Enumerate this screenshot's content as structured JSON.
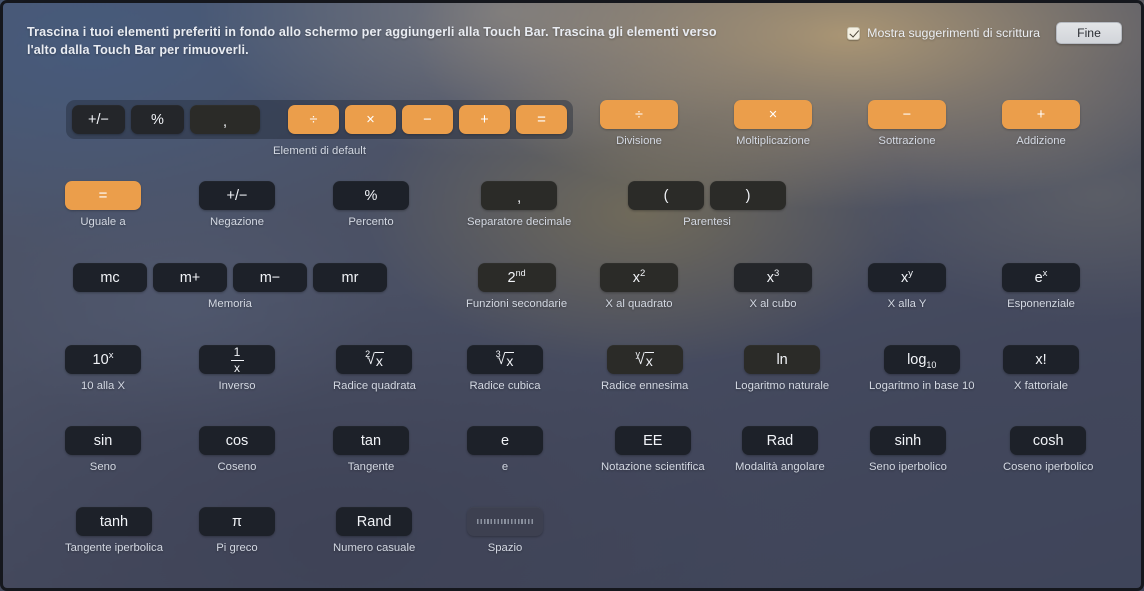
{
  "header": {
    "instructions": "Trascina i tuoi elementi preferiti in fondo allo schermo per aggiungerli alla Touch Bar. Trascina gli elementi verso l'alto dalla Touch Bar per rimuoverli.",
    "suggestions_label": "Mostra suggerimenti di scrittura",
    "suggestions_checked": true,
    "done_label": "Fine"
  },
  "colors": {
    "accent_orange": "#eb9e4b",
    "button_dark": "#1d2129",
    "caption_text": "#d3d8e2"
  },
  "default_tray": {
    "caption": "Elementi di default",
    "items": [
      {
        "glyph": "+/−",
        "name": "negate"
      },
      {
        "glyph": "%",
        "name": "percent"
      },
      {
        "glyph": ",",
        "name": "decimal-separator"
      },
      {
        "glyph": "÷",
        "name": "divide",
        "accent": true
      },
      {
        "glyph": "×",
        "name": "multiply",
        "accent": true
      },
      {
        "glyph": "−",
        "name": "subtract",
        "accent": true
      },
      {
        "glyph": "+",
        "name": "add",
        "accent": true
      },
      {
        "glyph": "=",
        "name": "equals",
        "accent": true
      }
    ]
  },
  "rows": [
    {
      "name": "row-operators",
      "items": [
        {
          "glyph": "÷",
          "caption": "Divisione",
          "name": "divisione"
        },
        {
          "glyph": "×",
          "caption": "Moltiplicazione",
          "name": "moltiplicazione"
        },
        {
          "glyph": "−",
          "caption": "Sottrazione",
          "name": "sottrazione"
        },
        {
          "glyph": "+",
          "caption": "Addizione",
          "name": "addizione"
        }
      ]
    },
    {
      "name": "row-basic",
      "items": [
        {
          "glyph": "=",
          "caption": "Uguale a",
          "name": "uguale-a"
        },
        {
          "glyph": "+/−",
          "caption": "Negazione",
          "name": "negazione"
        },
        {
          "glyph": "%",
          "caption": "Percento",
          "name": "percento"
        },
        {
          "glyph": ",",
          "caption": "Separatore decimale",
          "name": "separatore-decimale"
        },
        {
          "glyph": "(",
          "caption": "Parentesi",
          "name": "parentesi-aperta"
        },
        {
          "glyph": ")",
          "caption": "",
          "name": "parentesi-chiusa"
        }
      ]
    },
    {
      "name": "row-memory-powers",
      "items": [
        {
          "glyph": "mc",
          "caption": "Memoria",
          "name": "memoria-mc"
        },
        {
          "glyph": "m+",
          "caption": "",
          "name": "memoria-m-plus"
        },
        {
          "glyph": "m−",
          "caption": "",
          "name": "memoria-m-minus"
        },
        {
          "glyph": "mr",
          "caption": "",
          "name": "memoria-mr"
        },
        {
          "glyph": "2nd",
          "caption": "Funzioni secondarie",
          "name": "funzioni-secondarie"
        },
        {
          "glyph": "x2",
          "caption": "X al quadrato",
          "name": "x-al-quadrato"
        },
        {
          "glyph": "x3",
          "caption": "X al cubo",
          "name": "x-al-cubo"
        },
        {
          "glyph": "xy",
          "caption": "X alla Y",
          "name": "x-alla-y"
        },
        {
          "glyph": "ex",
          "caption": "Esponenziale",
          "name": "esponenziale"
        }
      ]
    },
    {
      "name": "row-roots-logs",
      "items": [
        {
          "glyph": "10x",
          "caption": "10 alla X",
          "name": "dieci-alla-x"
        },
        {
          "glyph": "1/x",
          "caption": "Inverso",
          "name": "inverso"
        },
        {
          "glyph": "root2",
          "caption": "Radice quadrata",
          "name": "radice-quadrata"
        },
        {
          "glyph": "root3",
          "caption": "Radice cubica",
          "name": "radice-cubica"
        },
        {
          "glyph": "rooty",
          "caption": "Radice ennesima",
          "name": "radice-ennesima"
        },
        {
          "glyph": "ln",
          "caption": "Logaritmo naturale",
          "name": "logaritmo-naturale"
        },
        {
          "glyph": "log10",
          "caption": "Logaritmo in base 10",
          "name": "logaritmo-base-10"
        },
        {
          "glyph": "x!",
          "caption": "X fattoriale",
          "name": "x-fattoriale"
        }
      ]
    },
    {
      "name": "row-trig",
      "items": [
        {
          "glyph": "sin",
          "caption": "Seno",
          "name": "seno"
        },
        {
          "glyph": "cos",
          "caption": "Coseno",
          "name": "coseno"
        },
        {
          "glyph": "tan",
          "caption": "Tangente",
          "name": "tangente"
        },
        {
          "glyph": "e",
          "caption": "e",
          "name": "e"
        },
        {
          "glyph": "EE",
          "caption": "Notazione scientifica",
          "name": "notazione-scientifica"
        },
        {
          "glyph": "Rad",
          "caption": "Modalità angolare",
          "name": "modalita-angolare"
        },
        {
          "glyph": "sinh",
          "caption": "Seno iperbolico",
          "name": "seno-iperbolico"
        },
        {
          "glyph": "cosh",
          "caption": "Coseno iperbolico",
          "name": "coseno-iperbolico"
        }
      ]
    },
    {
      "name": "row-misc",
      "items": [
        {
          "glyph": "tanh",
          "caption": "Tangente iperbolica",
          "name": "tangente-iperbolica"
        },
        {
          "glyph": "π",
          "caption": "Pi greco",
          "name": "pi-greco"
        },
        {
          "glyph": "Rand",
          "caption": "Numero casuale",
          "name": "numero-casuale"
        },
        {
          "glyph": "spacer",
          "caption": "Spazio",
          "name": "spazio"
        }
      ]
    }
  ]
}
